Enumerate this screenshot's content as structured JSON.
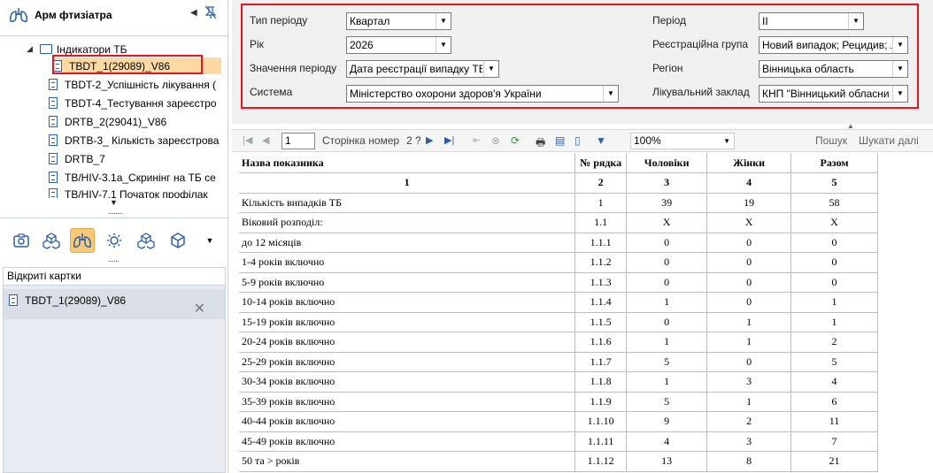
{
  "app": {
    "title": "Арм фтизіатра"
  },
  "tree": {
    "root_label": "Індикатори ТБ",
    "items": [
      {
        "label": "TBDT_1(29089)_V86",
        "selected": true
      },
      {
        "label": "TBDT-2_Успішність лікування ("
      },
      {
        "label": "TBDT-4_Тестування зареєстро"
      },
      {
        "label": "DRTB_2(29041)_V86"
      },
      {
        "label": "DRTB-3_ Кількість зареєстрова"
      },
      {
        "label": "DRTB_7"
      },
      {
        "label": "TB/HIV-3.1a_Скринінг на ТБ се"
      },
      {
        "label": "TB/HIV-7.1 Початок профілак"
      }
    ]
  },
  "open_cards": {
    "label": "Відкриті картки",
    "items": [
      {
        "label": "TBDT_1(29089)_V86"
      }
    ]
  },
  "params": {
    "period_type": {
      "label": "Тип періоду",
      "value": "Квартал"
    },
    "year": {
      "label": "Рік",
      "value": "2026"
    },
    "period_value": {
      "label": "Значення періоду",
      "value": "Дата реєстрації випадку ТБ"
    },
    "system": {
      "label": "Система",
      "value": "Міністерство охорони здоров'я України"
    },
    "period": {
      "label": "Період",
      "value": "II"
    },
    "reg_group": {
      "label": "Реєстраційна група",
      "value": "Новий випадок; Рецидив; Л"
    },
    "region": {
      "label": "Регіон",
      "value": "Вінницька область"
    },
    "facility": {
      "label": "Лікувальний заклад",
      "value": "КНП \"Вінницький обласни"
    }
  },
  "viewer": {
    "page_input": "1",
    "page_label": "Сторінка номер",
    "page_total": "2 ?",
    "zoom": "100%",
    "search_label": "Пошук",
    "search_next_label": "Шукати далі"
  },
  "report": {
    "headers": [
      "Назва показника",
      "№ рядка",
      "Чоловіки",
      "Жінки",
      "Разом"
    ],
    "col_numbers": [
      "1",
      "2",
      "3",
      "4",
      "5"
    ],
    "rows": [
      [
        "Кількість випадків ТБ",
        "1",
        "39",
        "19",
        "58"
      ],
      [
        "Віковий розподіл:",
        "1.1",
        "X",
        "X",
        "X"
      ],
      [
        "до 12 місяців",
        "1.1.1",
        "0",
        "0",
        "0"
      ],
      [
        "1-4 років включно",
        "1.1.2",
        "0",
        "0",
        "0"
      ],
      [
        "5-9 років включно",
        "1.1.3",
        "0",
        "0",
        "0"
      ],
      [
        "10-14 років включно",
        "1.1.4",
        "1",
        "0",
        "1"
      ],
      [
        "15-19 років включно",
        "1.1.5",
        "0",
        "1",
        "1"
      ],
      [
        "20-24 років включно",
        "1.1.6",
        "1",
        "1",
        "2"
      ],
      [
        "25-29 років включно",
        "1.1.7",
        "5",
        "0",
        "5"
      ],
      [
        "30-34 років включно",
        "1.1.8",
        "1",
        "3",
        "4"
      ],
      [
        "35-39 років включно",
        "1.1.9",
        "5",
        "1",
        "6"
      ],
      [
        "40-44 років включно",
        "1.1.10",
        "9",
        "2",
        "11"
      ],
      [
        "45-49 років включно",
        "1.1.11",
        "4",
        "3",
        "7"
      ],
      [
        "50 та > років",
        "1.1.12",
        "13",
        "8",
        "21"
      ]
    ]
  },
  "colors": {
    "highlight_red": "#e8141c",
    "selection": "#fcd9a3",
    "active_tool": "#f7c978",
    "icon_blue": "#2b5fa8"
  }
}
